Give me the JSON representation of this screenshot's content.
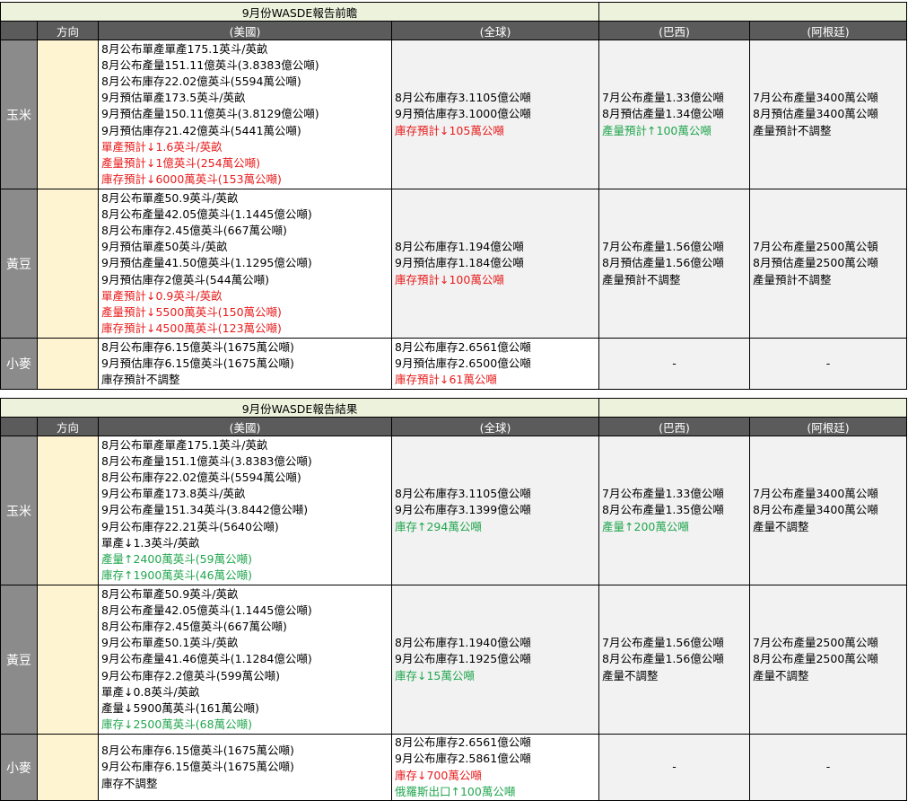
{
  "colors": {
    "red": "#e81c1c",
    "green": "#22a64f",
    "header": "#5b5b5b",
    "category": "#8b8b8b",
    "direction": "#fff4d2",
    "title": "#ecf2dc"
  },
  "headers": {
    "direction": "方向",
    "us": "(美國)",
    "global": "(全球)",
    "brazil": "(巴西)",
    "argentina": "(阿根廷)"
  },
  "preview": {
    "title": "9月份WASDE報告前瞻",
    "corn": {
      "label": "玉米",
      "us": [
        {
          "t": "8月公布單產單產175.1英斗/英畝",
          "c": ""
        },
        {
          "t": "8月公布產量151.11億英斗(3.8383億公噸)",
          "c": ""
        },
        {
          "t": "8月公布庫存22.02億英斗(5594萬公噸)",
          "c": ""
        },
        {
          "t": "9月預估單產173.5英斗/英畝",
          "c": ""
        },
        {
          "t": "9月預估產量150.11億英斗(3.8129億公噸)",
          "c": ""
        },
        {
          "t": "9月預估庫存21.42億英斗(5441萬公噸)",
          "c": ""
        },
        {
          "t": "單產預計↓1.6英斗/英畝",
          "c": "red"
        },
        {
          "t": "產量預計↓1億英斗(254萬公噸)",
          "c": "red"
        },
        {
          "t": "庫存預計↓6000萬英斗(153萬公噸)",
          "c": "red"
        }
      ],
      "global": [
        {
          "t": "8月公布庫存3.1105億公噸",
          "c": ""
        },
        {
          "t": "9月預估庫存3.1000億公噸",
          "c": ""
        },
        {
          "t": "庫存預計↓105萬公噸",
          "c": "red"
        }
      ],
      "brazil": [
        {
          "t": "7月公布產量1.33億公噸",
          "c": ""
        },
        {
          "t": "8月預估產量1.34億公噸",
          "c": ""
        },
        {
          "t": "產量預計↑100萬公噸",
          "c": "green"
        }
      ],
      "argentina": [
        {
          "t": "7月公布產量3400萬公噸",
          "c": ""
        },
        {
          "t": "8月預估產量3400萬公噸",
          "c": ""
        },
        {
          "t": "產量預計不調整",
          "c": ""
        }
      ]
    },
    "soy": {
      "label": "黃豆",
      "us": [
        {
          "t": "8月公布單產50.9英斗/英畝",
          "c": ""
        },
        {
          "t": "8月公布產量42.05億英斗(1.1445億公噸)",
          "c": ""
        },
        {
          "t": "8月公布庫存2.45億英斗(667萬公噸)",
          "c": ""
        },
        {
          "t": "9月預估單產50英斗/英畝",
          "c": ""
        },
        {
          "t": "9月預估產量41.50億英斗(1.1295億公噸)",
          "c": ""
        },
        {
          "t": "9月預估庫存2億英斗(544萬公噸)",
          "c": ""
        },
        {
          "t": "單產預計↓0.9英斗/英畝",
          "c": "red"
        },
        {
          "t": "產量預計↓5500萬英斗(150萬公噸)",
          "c": "red"
        },
        {
          "t": "庫存預計↓4500萬英斗(123萬公噸)",
          "c": "red"
        }
      ],
      "global": [
        {
          "t": "8月公布庫存1.194億公噸",
          "c": ""
        },
        {
          "t": "9月預估庫存1.184億公噸",
          "c": ""
        },
        {
          "t": "庫存預計↓100萬公噸",
          "c": "red"
        }
      ],
      "brazil": [
        {
          "t": "7月公布產量1.56億公噸",
          "c": ""
        },
        {
          "t": "8月預估產量1.56億公噸",
          "c": ""
        },
        {
          "t": "產量預計不調整",
          "c": ""
        }
      ],
      "argentina": [
        {
          "t": "7月公布產量2500萬公頓",
          "c": ""
        },
        {
          "t": "8月預估產量2500萬公噸",
          "c": ""
        },
        {
          "t": "產量預計不調整",
          "c": ""
        }
      ]
    },
    "wheat": {
      "label": "小麥",
      "us": [
        {
          "t": "8月公布庫存6.15億英斗(1675萬公噸)",
          "c": ""
        },
        {
          "t": "9月預估庫存6.15億英斗(1675萬公噸)",
          "c": ""
        },
        {
          "t": "庫存預計不調整",
          "c": ""
        }
      ],
      "global": [
        {
          "t": "8月公布庫存2.6561億公噸",
          "c": ""
        },
        {
          "t": "9月預估庫存2.6500億公噸",
          "c": ""
        },
        {
          "t": "庫存預計↓61萬公噸",
          "c": "red"
        }
      ],
      "brazil": "-",
      "argentina": "-"
    }
  },
  "result": {
    "title": "9月份WASDE報告結果",
    "corn": {
      "label": "玉米",
      "us": [
        {
          "t": "8月公布單產單產175.1英斗/英畝",
          "c": ""
        },
        {
          "t": "8月公布產量151.1億英斗(3.8383億公噸)",
          "c": ""
        },
        {
          "t": "8月公布庫存22.02億英斗(5594萬公噸)",
          "c": ""
        },
        {
          "t": "9月公布單產173.8英斗/英畝",
          "c": ""
        },
        {
          "t": "9月公布產量151.34英斗(3.8442億公噸)",
          "c": ""
        },
        {
          "t": "9月公布庫存22.21英斗(5640公噸)",
          "c": ""
        },
        {
          "t": "單產↓1.3英斗/英畝",
          "c": ""
        },
        {
          "t": "產量↑2400萬英斗(59萬公噸)",
          "c": "green"
        },
        {
          "t": "庫存↑1900萬英斗(46萬公噸)",
          "c": "green"
        }
      ],
      "global": [
        {
          "t": "8月公布庫存3.1105億公噸",
          "c": ""
        },
        {
          "t": "9月公布庫存3.1399億公噸",
          "c": ""
        },
        {
          "t": "庫存↑294萬公噸",
          "c": "green"
        }
      ],
      "brazil": [
        {
          "t": "7月公布產量1.33億公噸",
          "c": ""
        },
        {
          "t": "8月公布產量1.35億公噸",
          "c": ""
        },
        {
          "t": "產量↑200萬公噸",
          "c": "green"
        }
      ],
      "argentina": [
        {
          "t": "7月公布產量3400萬公噸",
          "c": ""
        },
        {
          "t": "8月公布產量3400萬公噸",
          "c": ""
        },
        {
          "t": "產量不調整",
          "c": ""
        }
      ]
    },
    "soy": {
      "label": "黃豆",
      "us": [
        {
          "t": "8月公布單產50.9英斗/英畝",
          "c": ""
        },
        {
          "t": "8月公布產量42.05億英斗(1.1445億公噸)",
          "c": ""
        },
        {
          "t": "8月公布庫存2.45億英斗(667萬公噸)",
          "c": ""
        },
        {
          "t": "9月公布單產50.1英斗/英畝",
          "c": ""
        },
        {
          "t": "9月公布產量41.46億英斗(1.1284億公噸)",
          "c": ""
        },
        {
          "t": "9月公布庫存2.2億英斗(599萬公噸)",
          "c": ""
        },
        {
          "t": "單產↓0.8英斗/英畝",
          "c": ""
        },
        {
          "t": "產量↓5900萬英斗(161萬公噸)",
          "c": ""
        },
        {
          "t": "庫存↓2500萬英斗(68萬公噸)",
          "c": "green"
        }
      ],
      "global": [
        {
          "t": "8月公布庫存1.1940億公噸",
          "c": ""
        },
        {
          "t": "9月公布庫存1.1925億公噸",
          "c": ""
        },
        {
          "t": "庫存↓15萬公噸",
          "c": "green"
        }
      ],
      "brazil": [
        {
          "t": "7月公布產量1.56億公噸",
          "c": ""
        },
        {
          "t": "8月公布產量1.56億公噸",
          "c": ""
        },
        {
          "t": "產量不調整",
          "c": ""
        }
      ],
      "argentina": [
        {
          "t": "7月公布產量2500萬公噸",
          "c": ""
        },
        {
          "t": "8月公布產量2500萬公噸",
          "c": ""
        },
        {
          "t": "產量不調整",
          "c": ""
        }
      ]
    },
    "wheat": {
      "label": "小麥",
      "us": [
        {
          "t": "8月公布庫存6.15億英斗(1675萬公噸)",
          "c": ""
        },
        {
          "t": "9月公布庫存6.15億英斗(1675萬公噸)",
          "c": ""
        },
        {
          "t": "庫存不調整",
          "c": ""
        }
      ],
      "global": [
        {
          "t": "8月公布庫存2.6561億公噸",
          "c": ""
        },
        {
          "t": "9月公布庫存2.5861億公噸",
          "c": ""
        },
        {
          "t": "庫存↓700萬公噸",
          "c": "red"
        },
        {
          "t": "俄羅斯出口↑100萬公噸",
          "c": "green"
        }
      ],
      "brazil": "-",
      "argentina": "-"
    }
  }
}
